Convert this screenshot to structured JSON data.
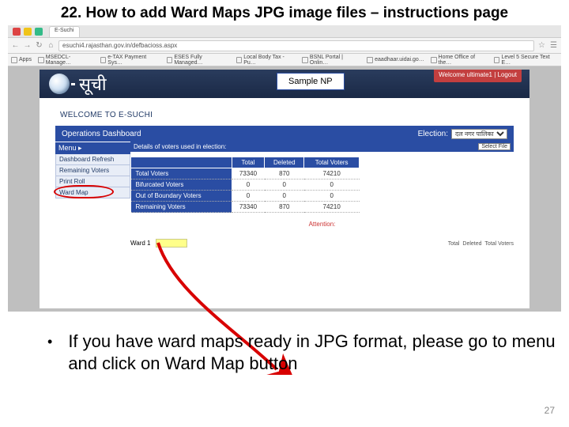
{
  "slide": {
    "title": "22. How to add Ward Maps JPG image files – instructions page",
    "pageNumber": "27"
  },
  "browser": {
    "tabLabel": "E-Suchi",
    "url": "esuchi4.rajasthan.gov.in/defbacioss.aspx",
    "bookmarks": [
      {
        "label": "Apps"
      },
      {
        "label": "MSEDCL-Manage…"
      },
      {
        "label": "e-TAX Payment Sys…"
      },
      {
        "label": "ESES Fully Managed…"
      },
      {
        "label": "Local Body Tax - Pu…"
      },
      {
        "label": "BSNL Portal | Onlin…"
      },
      {
        "label": "eaadhaar.uidai.go…"
      },
      {
        "label": "Home Office of the…"
      },
      {
        "label": "Level 5 Secure Text E…"
      }
    ]
  },
  "app": {
    "brand": "सूची",
    "sampleLabel": "Sample NP",
    "welcomeStrip": "Welcome ultimate1 | Logout",
    "welcomeText": "Welcome to E-Suchi",
    "dashTitle": "Operations Dashboard",
    "electionLabel": "Election:",
    "electionValue": "दल नगर पालिका",
    "menuHeader": "Menu",
    "menu": [
      {
        "label": "Dashboard Refresh",
        "circled": false
      },
      {
        "label": "Remaining Voters",
        "circled": false
      },
      {
        "label": "Print Roll",
        "circled": false
      },
      {
        "label": "Ward Map",
        "circled": true
      }
    ],
    "tableHeader": "Details of voters used in election:",
    "selectFile": "Select File",
    "cols": [
      "",
      "Total",
      "Deleted",
      "Total Voters"
    ],
    "rows": [
      {
        "h": "Total Voters",
        "c": [
          "73340",
          "870",
          "74210"
        ]
      },
      {
        "h": "Bifurcated Voters",
        "c": [
          "0",
          "0",
          "0"
        ]
      },
      {
        "h": "Out of Boundary Voters",
        "c": [
          "0",
          "0",
          "0"
        ]
      },
      {
        "h": "Remaining Voters",
        "c": [
          "73340",
          "870",
          "74210"
        ]
      }
    ],
    "attention": "Attention:",
    "wardLabel": "Ward 1",
    "totalsHead": [
      "Total",
      "Deleted",
      "Total Voters"
    ]
  },
  "bullet": "If you have ward maps ready in JPG format, please go to menu and click on Ward Map button"
}
